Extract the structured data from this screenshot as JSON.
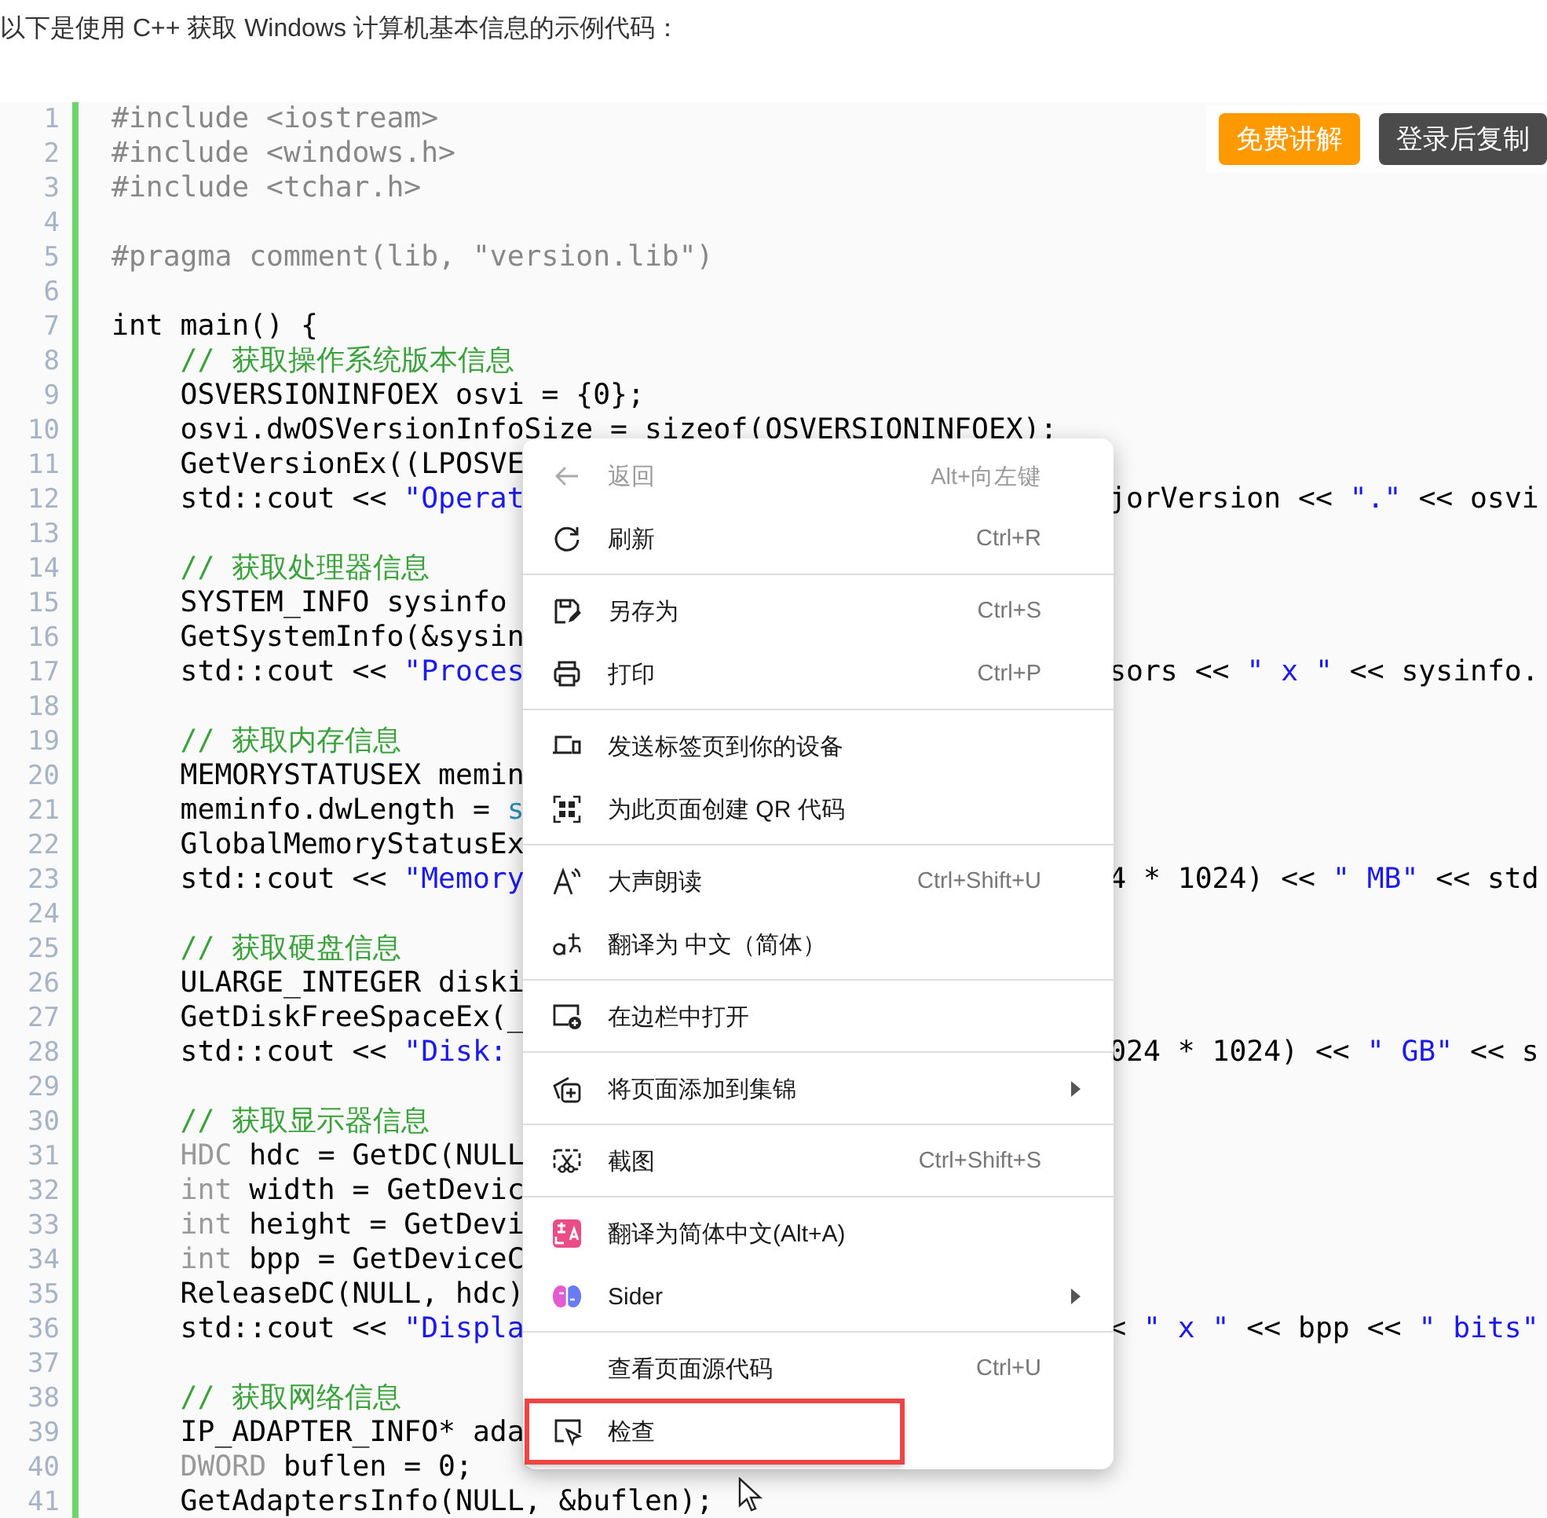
{
  "intro": "以下是使用 C++ 获取 Windows 计算机基本信息的示例代码：",
  "code_buttons": [
    {
      "label": "免费讲解",
      "kind": "primary"
    },
    {
      "label": "登录后复制",
      "kind": "dark"
    }
  ],
  "code_lines": [
    {
      "number": "1",
      "tokens": [
        {
          "kind": "preproc",
          "text": "#include <iostream>"
        }
      ]
    },
    {
      "number": "2",
      "tokens": [
        {
          "kind": "preproc",
          "text": "#include <windows.h>"
        }
      ]
    },
    {
      "number": "3",
      "tokens": [
        {
          "kind": "preproc",
          "text": "#include <tchar.h>"
        }
      ]
    },
    {
      "number": "4"
    },
    {
      "number": "5",
      "tokens": [
        {
          "kind": "preproc",
          "text": "#pragma comment(lib, \"version.lib\")"
        }
      ]
    },
    {
      "number": "6"
    },
    {
      "number": "7",
      "tokens": [
        {
          "kind": "plain",
          "text": "int main() {"
        }
      ]
    },
    {
      "number": "8",
      "tokens": [
        {
          "kind": "comment",
          "text": "    // 获取操作系统版本信息"
        }
      ]
    },
    {
      "number": "9",
      "tokens": [
        {
          "kind": "plain",
          "text": "    OSVERSIONINFOEX osvi = {0};"
        }
      ]
    },
    {
      "number": "10",
      "tokens": [
        {
          "kind": "plain",
          "text": "    osvi.dwOSVersionInfoSize = sizeof(OSVERSIONINFOEX);"
        }
      ]
    },
    {
      "number": "11",
      "tokens": [
        {
          "kind": "plain",
          "text": "    GetVersionEx((LPOSVE"
        }
      ]
    },
    {
      "number": "12",
      "tokens": [
        {
          "kind": "plain",
          "text": "    std::cout << "
        },
        {
          "kind": "string",
          "text": "\"Operat"
        }
      ],
      "tail": [
        {
          "kind": "plain",
          "text": "jorVersion << "
        },
        {
          "kind": "string",
          "text": "\".\""
        },
        {
          "kind": "plain",
          "text": " << osvi"
        }
      ]
    },
    {
      "number": "13"
    },
    {
      "number": "14",
      "tokens": [
        {
          "kind": "comment",
          "text": "    // 获取处理器信息"
        }
      ]
    },
    {
      "number": "15",
      "tokens": [
        {
          "kind": "plain",
          "text": "    SYSTEM_INFO sysinfo"
        }
      ]
    },
    {
      "number": "16",
      "tokens": [
        {
          "kind": "plain",
          "text": "    GetSystemInfo(&sysin"
        }
      ]
    },
    {
      "number": "17",
      "tokens": [
        {
          "kind": "plain",
          "text": "    std::cout << "
        },
        {
          "kind": "string",
          "text": "\"Proces"
        }
      ],
      "tail": [
        {
          "kind": "plain",
          "text": "sors << "
        },
        {
          "kind": "string",
          "text": "\" x \""
        },
        {
          "kind": "plain",
          "text": " << sysinfo."
        }
      ]
    },
    {
      "number": "18"
    },
    {
      "number": "19",
      "tokens": [
        {
          "kind": "comment",
          "text": "    // 获取内存信息"
        }
      ]
    },
    {
      "number": "20",
      "tokens": [
        {
          "kind": "plain",
          "text": "    MEMORYSTATUSEX memin"
        }
      ]
    },
    {
      "number": "21",
      "tokens": [
        {
          "kind": "plain",
          "text": "    meminfo.dwLength = "
        },
        {
          "kind": "builtin",
          "text": "s"
        }
      ]
    },
    {
      "number": "22",
      "tokens": [
        {
          "kind": "plain",
          "text": "    GlobalMemoryStatusEx"
        }
      ]
    },
    {
      "number": "23",
      "tokens": [
        {
          "kind": "plain",
          "text": "    std::cout << "
        },
        {
          "kind": "string",
          "text": "\"Memory"
        }
      ],
      "tail": [
        {
          "kind": "plain",
          "text": "4 * 1024) << "
        },
        {
          "kind": "string",
          "text": "\" MB\""
        },
        {
          "kind": "plain",
          "text": " << std"
        }
      ]
    },
    {
      "number": "24"
    },
    {
      "number": "25",
      "tokens": [
        {
          "kind": "comment",
          "text": "    // 获取硬盘信息"
        }
      ]
    },
    {
      "number": "26",
      "tokens": [
        {
          "kind": "plain",
          "text": "    ULARGE_INTEGER diski"
        }
      ]
    },
    {
      "number": "27",
      "tokens": [
        {
          "kind": "plain",
          "text": "    GetDiskFreeSpaceEx(_"
        }
      ]
    },
    {
      "number": "28",
      "tokens": [
        {
          "kind": "plain",
          "text": "    std::cout << "
        },
        {
          "kind": "string",
          "text": "\"Disk:"
        }
      ],
      "tail": [
        {
          "kind": "plain",
          "text": "024 * 1024) << "
        },
        {
          "kind": "string",
          "text": "\" GB\""
        },
        {
          "kind": "plain",
          "text": " << s"
        }
      ]
    },
    {
      "number": "29"
    },
    {
      "number": "30",
      "tokens": [
        {
          "kind": "comment",
          "text": "    // 获取显示器信息"
        }
      ]
    },
    {
      "number": "31",
      "tokens": [
        {
          "kind": "keyword",
          "text": "    HDC"
        },
        {
          "kind": "plain",
          "text": " hdc = GetDC(NULL"
        }
      ]
    },
    {
      "number": "32",
      "tokens": [
        {
          "kind": "keyword",
          "text": "    int"
        },
        {
          "kind": "plain",
          "text": " width = GetDevic"
        }
      ]
    },
    {
      "number": "33",
      "tokens": [
        {
          "kind": "keyword",
          "text": "    int"
        },
        {
          "kind": "plain",
          "text": " height = GetDevi"
        }
      ]
    },
    {
      "number": "34",
      "tokens": [
        {
          "kind": "keyword",
          "text": "    int"
        },
        {
          "kind": "plain",
          "text": " bpp = GetDeviceC"
        }
      ]
    },
    {
      "number": "35",
      "tokens": [
        {
          "kind": "plain",
          "text": "    ReleaseDC(NULL, hdc)"
        }
      ]
    },
    {
      "number": "36",
      "tokens": [
        {
          "kind": "plain",
          "text": "    std::cout << "
        },
        {
          "kind": "string",
          "text": "\"Displa"
        }
      ],
      "tail": [
        {
          "kind": "plain",
          "text": "< "
        },
        {
          "kind": "string",
          "text": "\" x \""
        },
        {
          "kind": "plain",
          "text": " << bpp << "
        },
        {
          "kind": "string",
          "text": "\" bits\""
        }
      ]
    },
    {
      "number": "37"
    },
    {
      "number": "38",
      "tokens": [
        {
          "kind": "comment",
          "text": "    // 获取网络信息"
        }
      ]
    },
    {
      "number": "39",
      "tokens": [
        {
          "kind": "plain",
          "text": "    IP_ADAPTER_INFO* ada"
        }
      ]
    },
    {
      "number": "40",
      "tokens": [
        {
          "kind": "keyword",
          "text": "    DWORD"
        },
        {
          "kind": "plain",
          "text": " buflen = 0;"
        }
      ]
    },
    {
      "number": "41",
      "tokens": [
        {
          "kind": "plain",
          "text": "    GetAdaptersInfo(NULL, &buflen);"
        }
      ]
    }
  ],
  "context_menu": {
    "items": [
      {
        "kind": "item",
        "label": "返回",
        "shortcut": "Alt+向左键",
        "disabled": true,
        "submenu": false,
        "outlined": false
      },
      {
        "kind": "item",
        "label": "刷新",
        "shortcut": "Ctrl+R",
        "disabled": false,
        "submenu": false,
        "outlined": false
      },
      {
        "kind": "separator"
      },
      {
        "kind": "item",
        "label": "另存为",
        "shortcut": "Ctrl+S",
        "disabled": false,
        "submenu": false,
        "outlined": false
      },
      {
        "kind": "item",
        "label": "打印",
        "shortcut": "Ctrl+P",
        "disabled": false,
        "submenu": false,
        "outlined": false
      },
      {
        "kind": "separator"
      },
      {
        "kind": "item",
        "label": "发送标签页到你的设备",
        "disabled": false,
        "submenu": false,
        "outlined": false
      },
      {
        "kind": "item",
        "label": "为此页面创建 QR 代码",
        "disabled": false,
        "submenu": false,
        "outlined": false
      },
      {
        "kind": "separator"
      },
      {
        "kind": "item",
        "label": "大声朗读",
        "shortcut": "Ctrl+Shift+U",
        "disabled": false,
        "submenu": false,
        "outlined": false
      },
      {
        "kind": "item",
        "label": "翻译为 中文（简体）",
        "disabled": false,
        "submenu": false,
        "outlined": false
      },
      {
        "kind": "separator"
      },
      {
        "kind": "item",
        "label": "在边栏中打开",
        "disabled": false,
        "submenu": false,
        "outlined": false
      },
      {
        "kind": "separator"
      },
      {
        "kind": "item",
        "label": "将页面添加到集锦",
        "disabled": false,
        "submenu": true,
        "outlined": false
      },
      {
        "kind": "separator"
      },
      {
        "kind": "item",
        "label": "截图",
        "shortcut": "Ctrl+Shift+S",
        "disabled": false,
        "submenu": false,
        "outlined": false
      },
      {
        "kind": "separator"
      },
      {
        "kind": "item",
        "label": "翻译为简体中文(Alt+A)",
        "disabled": false,
        "submenu": false,
        "outlined": false
      },
      {
        "kind": "item",
        "label": "Sider",
        "disabled": false,
        "submenu": true,
        "outlined": false
      },
      {
        "kind": "separator"
      },
      {
        "kind": "item",
        "label": "查看页面源代码",
        "shortcut": "Ctrl+U",
        "disabled": false,
        "submenu": false,
        "outlined": false
      },
      {
        "kind": "item",
        "label": "检查",
        "disabled": false,
        "submenu": false,
        "outlined": true
      }
    ]
  }
}
